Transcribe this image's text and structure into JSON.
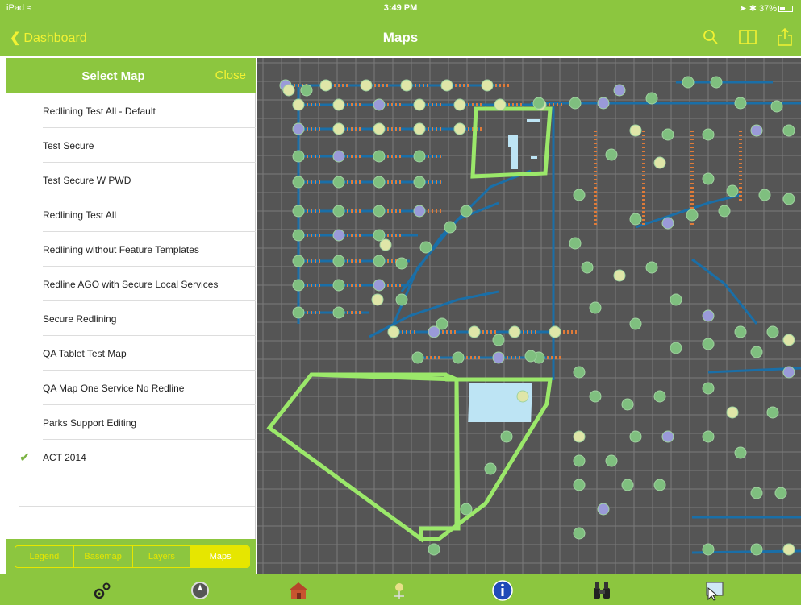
{
  "status": {
    "carrier": "iPad",
    "time": "3:49 PM",
    "battery_text": "37%"
  },
  "nav": {
    "back_label": "Dashboard",
    "title": "Maps",
    "icons": [
      "search-icon",
      "book-icon",
      "share-icon"
    ]
  },
  "panel": {
    "title": "Select Map",
    "close_label": "Close",
    "maps": [
      {
        "label": "Redlining Test All - Default",
        "selected": false
      },
      {
        "label": "Test Secure",
        "selected": false
      },
      {
        "label": "Test Secure W PWD",
        "selected": false
      },
      {
        "label": "Redlining Test All",
        "selected": false
      },
      {
        "label": "Redlining without Feature Templates",
        "selected": false
      },
      {
        "label": "Redline AGO with Secure Local Services",
        "selected": false
      },
      {
        "label": "Secure Redlining",
        "selected": false
      },
      {
        "label": "QA Tablet Test Map",
        "selected": false
      },
      {
        "label": "QA Map One Service No Redline",
        "selected": false
      },
      {
        "label": "Parks Support Editing",
        "selected": false
      },
      {
        "label": "ACT 2014",
        "selected": true
      }
    ],
    "tabs": [
      {
        "label": "Legend",
        "active": false
      },
      {
        "label": "Basemap",
        "active": false
      },
      {
        "label": "Layers",
        "active": false
      },
      {
        "label": "Maps",
        "active": true
      }
    ]
  },
  "toolbar": {
    "icons": [
      "gears-icon",
      "compass-icon",
      "house-icon",
      "gps-icon",
      "info-icon",
      "binoculars-icon",
      "select-tool-icon"
    ]
  },
  "colors": {
    "bar_green": "#8cc63f",
    "accent_yellow": "#e6e600",
    "map_background": "#555555",
    "boundary_green": "#9be86a",
    "pipe_blue": "#1a6fa8",
    "service_orange": "#e07b39"
  }
}
